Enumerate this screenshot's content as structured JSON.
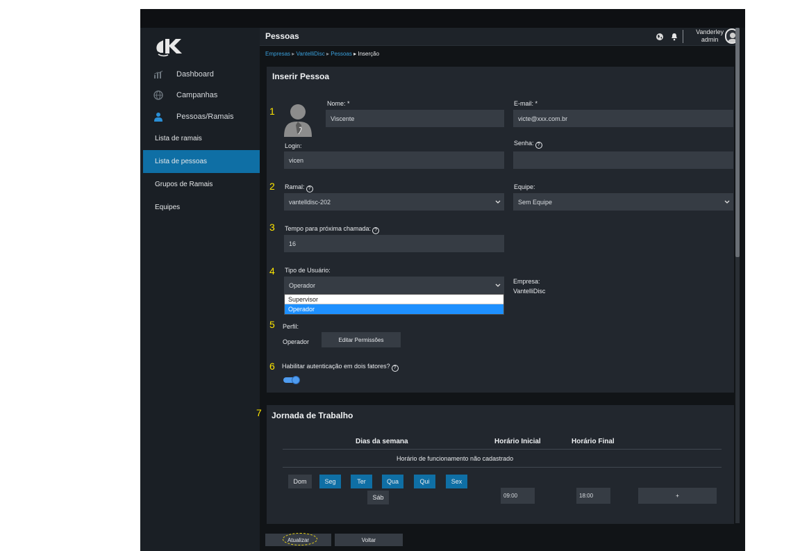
{
  "app": {
    "logo_text": "K",
    "header_title": "Pessoas",
    "user_name": "Vanderley",
    "user_role": "admin"
  },
  "sidebar": {
    "items": [
      {
        "label": "Dashboard",
        "icon": "bar-chart-icon"
      },
      {
        "label": "Campanhas",
        "icon": "globe-icon"
      },
      {
        "label": "Pessoas/Ramais",
        "icon": "person-icon"
      }
    ],
    "subitems": [
      {
        "label": "Lista de ramais"
      },
      {
        "label": "Lista de pessoas",
        "active": true
      },
      {
        "label": "Grupos de Ramais"
      },
      {
        "label": "Equipes"
      }
    ]
  },
  "breadcrumb": {
    "items": [
      "Empresas",
      "VantelliDisc",
      "Pessoas"
    ],
    "current": "Inserção"
  },
  "form": {
    "title": "Inserir Pessoa",
    "numbers": [
      "1",
      "2",
      "3",
      "4",
      "5",
      "6",
      "7"
    ],
    "nome_label": "Nome: *",
    "nome_value": "Viscente",
    "email_label": "E-mail: *",
    "email_value": "victe@xxx.com.br",
    "login_label": "Login:",
    "login_value": "vicen",
    "senha_label": "Senha:",
    "senha_value": "",
    "ramal_label": "Ramal:",
    "ramal_value": "vantelldisc-202",
    "equipe_label": "Equipe:",
    "equipe_value": "Sem Equipe",
    "tempo_label": "Tempo para próxima chamada:",
    "tempo_value": "16",
    "tipo_label": "Tipo de Usuário:",
    "tipo_value": "Operador",
    "tipo_options": [
      "Supervisor",
      "Operador"
    ],
    "empresa_label": "Empresa:",
    "empresa_value": "VantelliDisc",
    "perfil_label": "Perfil:",
    "perfil_value": "Operador",
    "editar_permissoes": "Editar Permissões",
    "twofa_label": "Habilitar autenticação em dois fatores?",
    "twofa_enabled": true
  },
  "jornada": {
    "title": "Jornada de Trabalho",
    "col_dias": "Dias da semana",
    "col_inicial": "Horário Inicial",
    "col_final": "Horário Final",
    "empty_message": "Horário de funcionamento não cadastrado",
    "days": [
      {
        "label": "Dom",
        "selected": false
      },
      {
        "label": "Seg",
        "selected": true
      },
      {
        "label": "Ter",
        "selected": true
      },
      {
        "label": "Qua",
        "selected": true
      },
      {
        "label": "Qui",
        "selected": true
      },
      {
        "label": "Sex",
        "selected": true
      },
      {
        "label": "Sáb",
        "selected": false
      }
    ],
    "hora_inicial": "09:00",
    "hora_final": "18:00",
    "add_label": "+"
  },
  "actions": {
    "atualizar": "Atualizar",
    "voltar": "Voltar"
  },
  "colors": {
    "accent": "#0f6fa5",
    "link": "#3aa0dc",
    "annotation": "#ffe600"
  }
}
